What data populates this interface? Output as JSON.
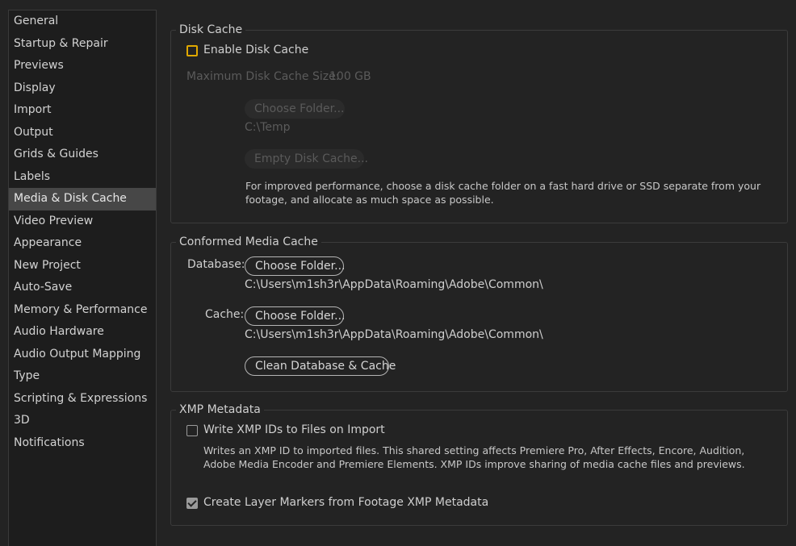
{
  "sidebar": {
    "items": [
      {
        "label": "General"
      },
      {
        "label": "Startup & Repair"
      },
      {
        "label": "Previews"
      },
      {
        "label": "Display"
      },
      {
        "label": "Import"
      },
      {
        "label": "Output"
      },
      {
        "label": "Grids & Guides"
      },
      {
        "label": "Labels"
      },
      {
        "label": "Media & Disk Cache",
        "active": true
      },
      {
        "label": "Video Preview"
      },
      {
        "label": "Appearance"
      },
      {
        "label": "New Project"
      },
      {
        "label": "Auto-Save"
      },
      {
        "label": "Memory & Performance"
      },
      {
        "label": "Audio Hardware"
      },
      {
        "label": "Audio Output Mapping"
      },
      {
        "label": "Type"
      },
      {
        "label": "Scripting & Expressions"
      },
      {
        "label": "3D"
      },
      {
        "label": "Notifications"
      }
    ]
  },
  "disk_cache": {
    "title": "Disk Cache",
    "enable_label": "Enable Disk Cache",
    "enable_checked": false,
    "max_size_label": "Maximum Disk Cache Size:",
    "max_size_value": "100 GB",
    "choose_folder_label": "Choose Folder...",
    "folder_path": "C:\\Temp",
    "empty_cache_label": "Empty Disk Cache...",
    "note": "For improved performance, choose a disk cache folder on a fast hard drive or SSD separate from your footage, and allocate as much space as possible."
  },
  "conformed_media_cache": {
    "title": "Conformed Media Cache",
    "database_label": "Database:",
    "database_button": "Choose Folder...",
    "database_path": "C:\\Users\\m1sh3r\\AppData\\Roaming\\Adobe\\Common\\",
    "cache_label": "Cache:",
    "cache_button": "Choose Folder...",
    "cache_path": "C:\\Users\\m1sh3r\\AppData\\Roaming\\Adobe\\Common\\",
    "clean_button": "Clean Database & Cache"
  },
  "xmp_metadata": {
    "title": "XMP Metadata",
    "write_ids_label": "Write XMP IDs to Files on Import",
    "write_ids_checked": false,
    "write_ids_note": "Writes an XMP ID to imported files. This shared setting affects Premiere Pro, After Effects, Encore, Audition, Adobe Media Encoder and Premiere Elements. XMP IDs improve sharing of media cache files and previews.",
    "layer_markers_label": "Create Layer Markers from Footage XMP Metadata",
    "layer_markers_checked": true
  },
  "colors": {
    "background": "#232323",
    "sidebar_background": "#1d1d1d",
    "sidebar_active": "#474747",
    "focus_accent": "#e0a800",
    "disabled_text": "#5b5b5b"
  }
}
